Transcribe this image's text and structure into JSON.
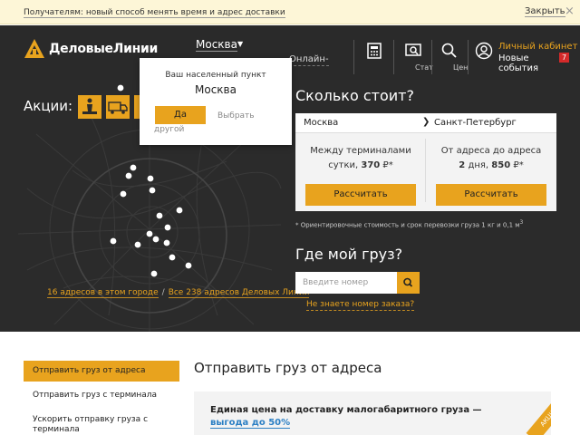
{
  "notice": {
    "message": "Получателям: новый способ менять время и адрес доставки",
    "close_label": "Закрыть",
    "close_icon": "×"
  },
  "header": {
    "logo_text": "ДеловыеЛинии",
    "city": "Москва",
    "online_label": "Онлайн-",
    "icons": [
      {
        "name": "calculator-icon",
        "label": ""
      },
      {
        "name": "status-icon",
        "label": "Стат"
      },
      {
        "name": "search-icon",
        "label": "Цен"
      }
    ],
    "cabinet_label": "Личный кабинет",
    "events_label": "Новые события",
    "events_count": "7"
  },
  "city_popup": {
    "title": "Ваш населенный пункт",
    "city": "Москва",
    "yes_label": "Да",
    "other_label": "Выбрать другой"
  },
  "promo": {
    "title": "Акции:",
    "tiles": [
      "worker-icon",
      "truck-icon",
      "promo-icon"
    ]
  },
  "map": {
    "local_link": "16 адресов в этом городе",
    "all_link": "Все 238 адресов Деловых Линий",
    "separator": "/"
  },
  "calculator": {
    "title": "Сколько стоит?",
    "from": "Москва",
    "to": "Санкт-Петербург",
    "columns": [
      {
        "line1": "Между терминалами",
        "days": "сутки,",
        "price": "370",
        "currency": "₽*",
        "button": "Рассчитать"
      },
      {
        "line1": "От адреса до адреса",
        "days_num": "2",
        "days": "дня,",
        "price": "850",
        "currency": "₽*",
        "button": "Рассчитать"
      }
    ],
    "footnote": "* Ориентировочные стоимость и срок перевозки груза 1 кг и 0,1 м",
    "footnote_sup": "3"
  },
  "tracking": {
    "title": "Где мой груз?",
    "placeholder": "Введите номер",
    "unknown_link": "Не знаете номер заказа?"
  },
  "sidenav": {
    "items": [
      "Отправить груз от адреса",
      "Отправить груз с терминала",
      "Ускорить отправку груза с терминала"
    ]
  },
  "section": {
    "title": "Отправить груз от адреса",
    "banner_text": "Единая цена на доставку малогабаритного груза —",
    "banner_link": "выгода до 50%",
    "ribbon": "АКЦИЯ"
  },
  "colors": {
    "accent": "#e8a31e",
    "dark": "#2b2b2b",
    "link_blue": "#2b7fc4",
    "badge_red": "#d42a2a"
  }
}
